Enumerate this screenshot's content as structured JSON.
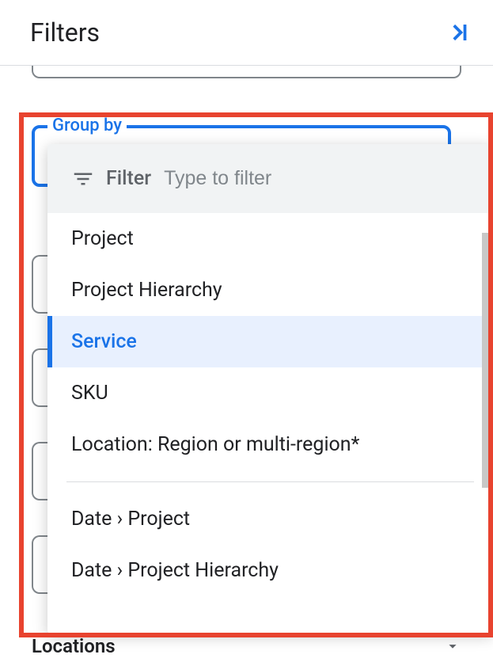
{
  "header": {
    "title": "Filters"
  },
  "group_by": {
    "label": "Group by"
  },
  "filter_box": {
    "label": "Filter",
    "placeholder": "Type to filter"
  },
  "options_a": [
    {
      "label": "Project",
      "selected": false
    },
    {
      "label": "Project Hierarchy",
      "selected": false
    },
    {
      "label": "Service",
      "selected": true
    },
    {
      "label": "SKU",
      "selected": false
    },
    {
      "label": "Location: Region or multi-region*",
      "selected": false
    }
  ],
  "options_b": [
    {
      "label": "Date › Project"
    },
    {
      "label": "Date › Project Hierarchy"
    }
  ],
  "locations": {
    "label": "Locations"
  }
}
